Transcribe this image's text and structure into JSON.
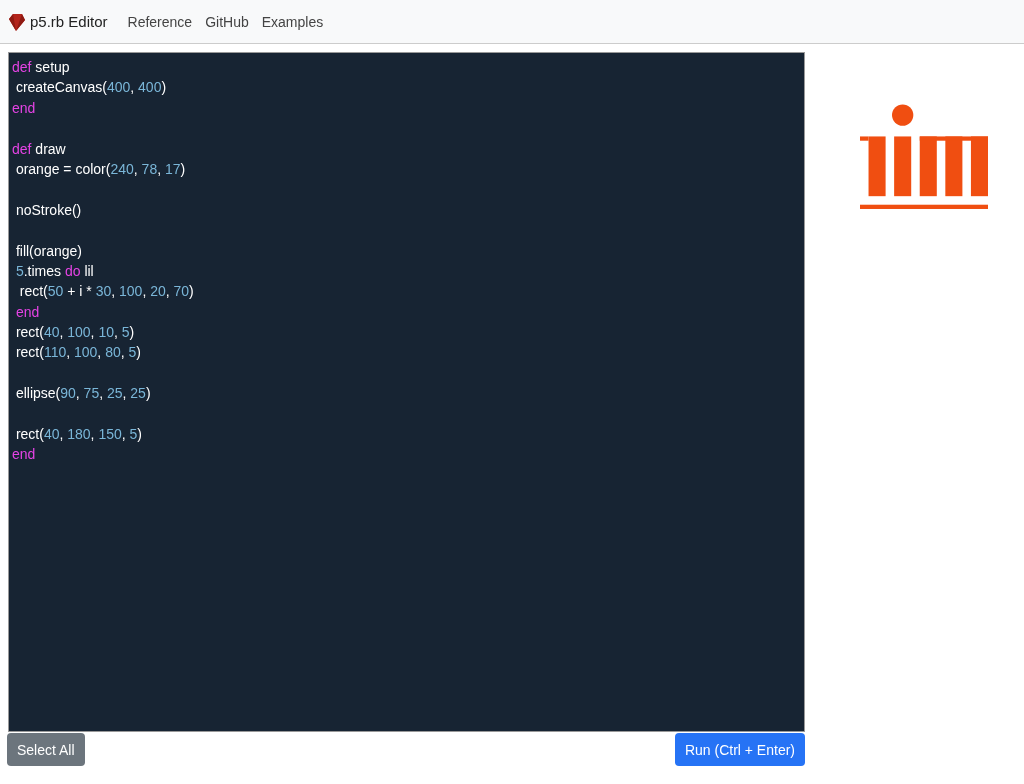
{
  "navbar": {
    "brand": "p5.rb Editor",
    "links": [
      "Reference",
      "GitHub",
      "Examples"
    ]
  },
  "editor": {
    "lines": [
      {
        "kind": "code",
        "tokens": [
          {
            "kind": "keyword",
            "text": "def"
          },
          {
            "kind": "plain",
            "text": " setup"
          }
        ]
      },
      {
        "kind": "code",
        "tokens": [
          {
            "kind": "plain",
            "text": " createCanvas("
          },
          {
            "kind": "number",
            "text": "400"
          },
          {
            "kind": "plain",
            "text": ", "
          },
          {
            "kind": "number",
            "text": "400"
          },
          {
            "kind": "plain",
            "text": ")"
          }
        ]
      },
      {
        "kind": "code",
        "tokens": [
          {
            "kind": "keyword",
            "text": "end"
          }
        ]
      },
      {
        "kind": "blank"
      },
      {
        "kind": "code",
        "tokens": [
          {
            "kind": "keyword",
            "text": "def"
          },
          {
            "kind": "plain",
            "text": " draw"
          }
        ]
      },
      {
        "kind": "code",
        "tokens": [
          {
            "kind": "plain",
            "text": " orange = color("
          },
          {
            "kind": "number",
            "text": "240"
          },
          {
            "kind": "plain",
            "text": ", "
          },
          {
            "kind": "number",
            "text": "78"
          },
          {
            "kind": "plain",
            "text": ", "
          },
          {
            "kind": "number",
            "text": "17"
          },
          {
            "kind": "plain",
            "text": ")"
          }
        ]
      },
      {
        "kind": "blank"
      },
      {
        "kind": "code",
        "tokens": [
          {
            "kind": "plain",
            "text": " noStroke()"
          }
        ]
      },
      {
        "kind": "blank"
      },
      {
        "kind": "code",
        "tokens": [
          {
            "kind": "plain",
            "text": " fill(orange)"
          }
        ]
      },
      {
        "kind": "code",
        "tokens": [
          {
            "kind": "number",
            "text": " 5"
          },
          {
            "kind": "plain",
            "text": ".times "
          },
          {
            "kind": "keyword",
            "text": "do"
          },
          {
            "kind": "plain",
            "text": " lil"
          }
        ]
      },
      {
        "kind": "code",
        "tokens": [
          {
            "kind": "plain",
            "text": "  rect("
          },
          {
            "kind": "number",
            "text": "50"
          },
          {
            "kind": "plain",
            "text": " + i * "
          },
          {
            "kind": "number",
            "text": "30"
          },
          {
            "kind": "plain",
            "text": ", "
          },
          {
            "kind": "number",
            "text": "100"
          },
          {
            "kind": "plain",
            "text": ", "
          },
          {
            "kind": "number",
            "text": "20"
          },
          {
            "kind": "plain",
            "text": ", "
          },
          {
            "kind": "number",
            "text": "70"
          },
          {
            "kind": "plain",
            "text": ")"
          }
        ]
      },
      {
        "kind": "code",
        "tokens": [
          {
            "kind": "keyword",
            "text": " end"
          }
        ]
      },
      {
        "kind": "code",
        "tokens": [
          {
            "kind": "plain",
            "text": " rect("
          },
          {
            "kind": "number",
            "text": "40"
          },
          {
            "kind": "plain",
            "text": ", "
          },
          {
            "kind": "number",
            "text": "100"
          },
          {
            "kind": "plain",
            "text": ", "
          },
          {
            "kind": "number",
            "text": "10"
          },
          {
            "kind": "plain",
            "text": ", "
          },
          {
            "kind": "number",
            "text": "5"
          },
          {
            "kind": "plain",
            "text": ")"
          }
        ]
      },
      {
        "kind": "code",
        "tokens": [
          {
            "kind": "plain",
            "text": " rect("
          },
          {
            "kind": "number",
            "text": "110"
          },
          {
            "kind": "plain",
            "text": ", "
          },
          {
            "kind": "number",
            "text": "100"
          },
          {
            "kind": "plain",
            "text": ", "
          },
          {
            "kind": "number",
            "text": "80"
          },
          {
            "kind": "plain",
            "text": ", "
          },
          {
            "kind": "number",
            "text": "5"
          },
          {
            "kind": "plain",
            "text": ")"
          }
        ]
      },
      {
        "kind": "blank"
      },
      {
        "kind": "code",
        "tokens": [
          {
            "kind": "plain",
            "text": " ellipse("
          },
          {
            "kind": "number",
            "text": "90"
          },
          {
            "kind": "plain",
            "text": ", "
          },
          {
            "kind": "number",
            "text": "75"
          },
          {
            "kind": "plain",
            "text": ", "
          },
          {
            "kind": "number",
            "text": "25"
          },
          {
            "kind": "plain",
            "text": ", "
          },
          {
            "kind": "number",
            "text": "25"
          },
          {
            "kind": "plain",
            "text": ")"
          }
        ]
      },
      {
        "kind": "blank"
      },
      {
        "kind": "code",
        "tokens": [
          {
            "kind": "plain",
            "text": " rect("
          },
          {
            "kind": "number",
            "text": "40"
          },
          {
            "kind": "plain",
            "text": ", "
          },
          {
            "kind": "number",
            "text": "180"
          },
          {
            "kind": "plain",
            "text": ", "
          },
          {
            "kind": "number",
            "text": "150"
          },
          {
            "kind": "plain",
            "text": ", "
          },
          {
            "kind": "number",
            "text": "5"
          },
          {
            "kind": "plain",
            "text": ")"
          }
        ]
      },
      {
        "kind": "code",
        "tokens": [
          {
            "kind": "keyword",
            "text": "end"
          }
        ]
      }
    ]
  },
  "buttons": {
    "select_all": "Select All",
    "run": "Run (Ctrl + Enter)"
  }
}
